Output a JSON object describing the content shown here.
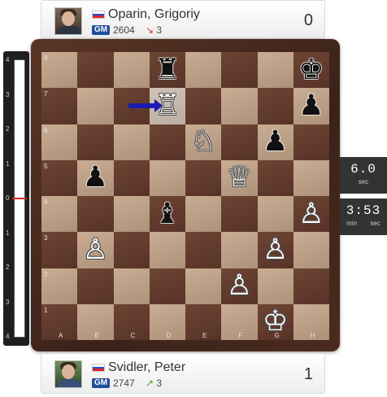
{
  "top_player": {
    "name": "Oparin, Grigoriy",
    "title": "GM",
    "rating": "2604",
    "rating_change": "3",
    "rating_change_direction": "down",
    "score": "0",
    "flag": "russia"
  },
  "bottom_player": {
    "name": "Svidler, Peter",
    "title": "GM",
    "rating": "2747",
    "rating_change": "3",
    "rating_change_direction": "up",
    "score": "1",
    "flag": "russia"
  },
  "eval_bar": {
    "ticks": [
      "4",
      "3",
      "2",
      "1",
      "0",
      "1",
      "2",
      "3",
      "4"
    ],
    "value": 0
  },
  "clock_1": {
    "value": "6.0",
    "unit": "sec"
  },
  "clock_2": {
    "value": "3:53",
    "unit_left": "min",
    "unit_right": "sec"
  },
  "board": {
    "ranks": [
      "8",
      "7",
      "6",
      "5",
      "4",
      "3",
      "2",
      "1"
    ],
    "files": [
      "A",
      "B",
      "C",
      "D",
      "E",
      "F",
      "G",
      "H"
    ],
    "pieces": [
      {
        "square": "d8",
        "piece": "rook",
        "color": "black"
      },
      {
        "square": "h8",
        "piece": "king",
        "color": "black"
      },
      {
        "square": "d7",
        "piece": "rook",
        "color": "white"
      },
      {
        "square": "h7",
        "piece": "pawn",
        "color": "black"
      },
      {
        "square": "e6",
        "piece": "knight",
        "color": "white"
      },
      {
        "square": "g6",
        "piece": "pawn",
        "color": "black"
      },
      {
        "square": "b5",
        "piece": "pawn",
        "color": "black"
      },
      {
        "square": "f5",
        "piece": "queen",
        "color": "white"
      },
      {
        "square": "d4",
        "piece": "bishop",
        "color": "black"
      },
      {
        "square": "h4",
        "piece": "pawn",
        "color": "white"
      },
      {
        "square": "b3",
        "piece": "pawn",
        "color": "white"
      },
      {
        "square": "g3",
        "piece": "pawn",
        "color": "white"
      },
      {
        "square": "f2",
        "piece": "pawn",
        "color": "white"
      },
      {
        "square": "g1",
        "piece": "king",
        "color": "white"
      }
    ],
    "last_move": {
      "from": "c7",
      "to": "d7"
    }
  }
}
